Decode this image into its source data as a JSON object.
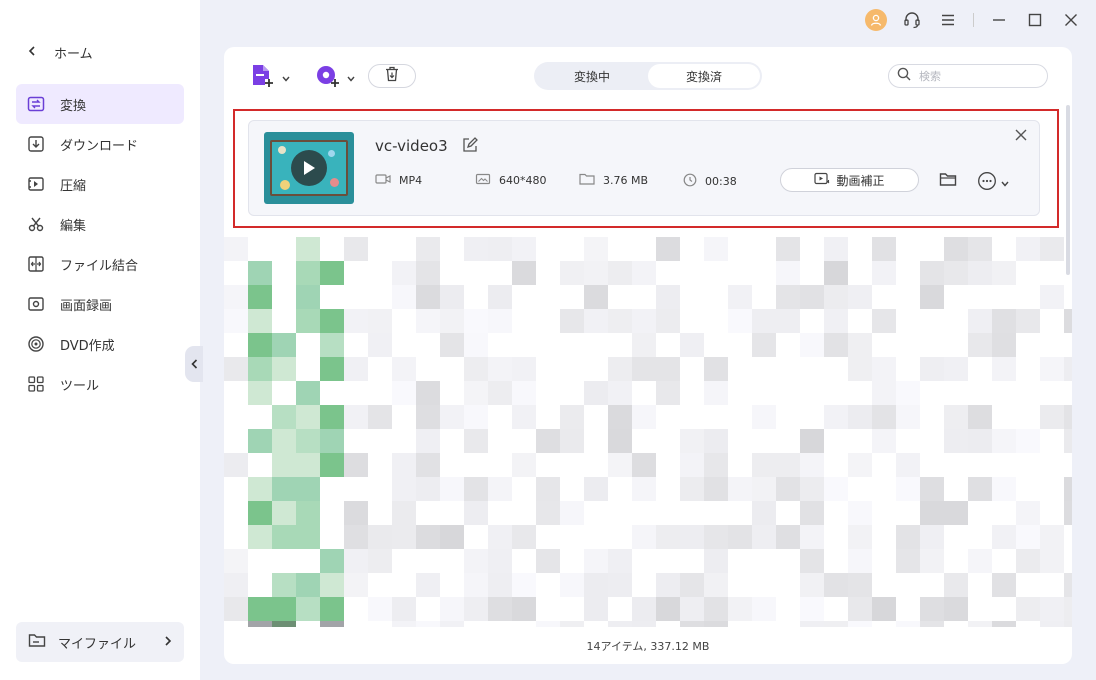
{
  "sidebar": {
    "home_label": "ホーム",
    "items": [
      {
        "label": "変換",
        "icon": "convert-icon",
        "active": true
      },
      {
        "label": "ダウンロード",
        "icon": "download-icon",
        "active": false
      },
      {
        "label": "圧縮",
        "icon": "compress-icon",
        "active": false
      },
      {
        "label": "編集",
        "icon": "scissors-icon",
        "active": false
      },
      {
        "label": "ファイル結合",
        "icon": "merge-icon",
        "active": false
      },
      {
        "label": "画面録画",
        "icon": "screen-record-icon",
        "active": false
      },
      {
        "label": "DVD作成",
        "icon": "dvd-icon",
        "active": false
      },
      {
        "label": "ツール",
        "icon": "tools-icon",
        "active": false
      }
    ],
    "myfiles_label": "マイファイル"
  },
  "toolbar": {
    "tabs": [
      {
        "label": "変換中",
        "active": false
      },
      {
        "label": "変換済",
        "active": true
      }
    ],
    "search_placeholder": "検索"
  },
  "file": {
    "name": "vc-video3",
    "format": "MP4",
    "resolution": "640*480",
    "size": "3.76 MB",
    "duration": "00:38",
    "enhance_label": "動画補正"
  },
  "footer": {
    "summary": "14アイテム, 337.12 MB"
  },
  "colors": {
    "accent": "#7b3fe4",
    "active_nav_bg": "#efeaff",
    "highlight_border": "#d32a2a",
    "avatar": "#f6b96b"
  }
}
